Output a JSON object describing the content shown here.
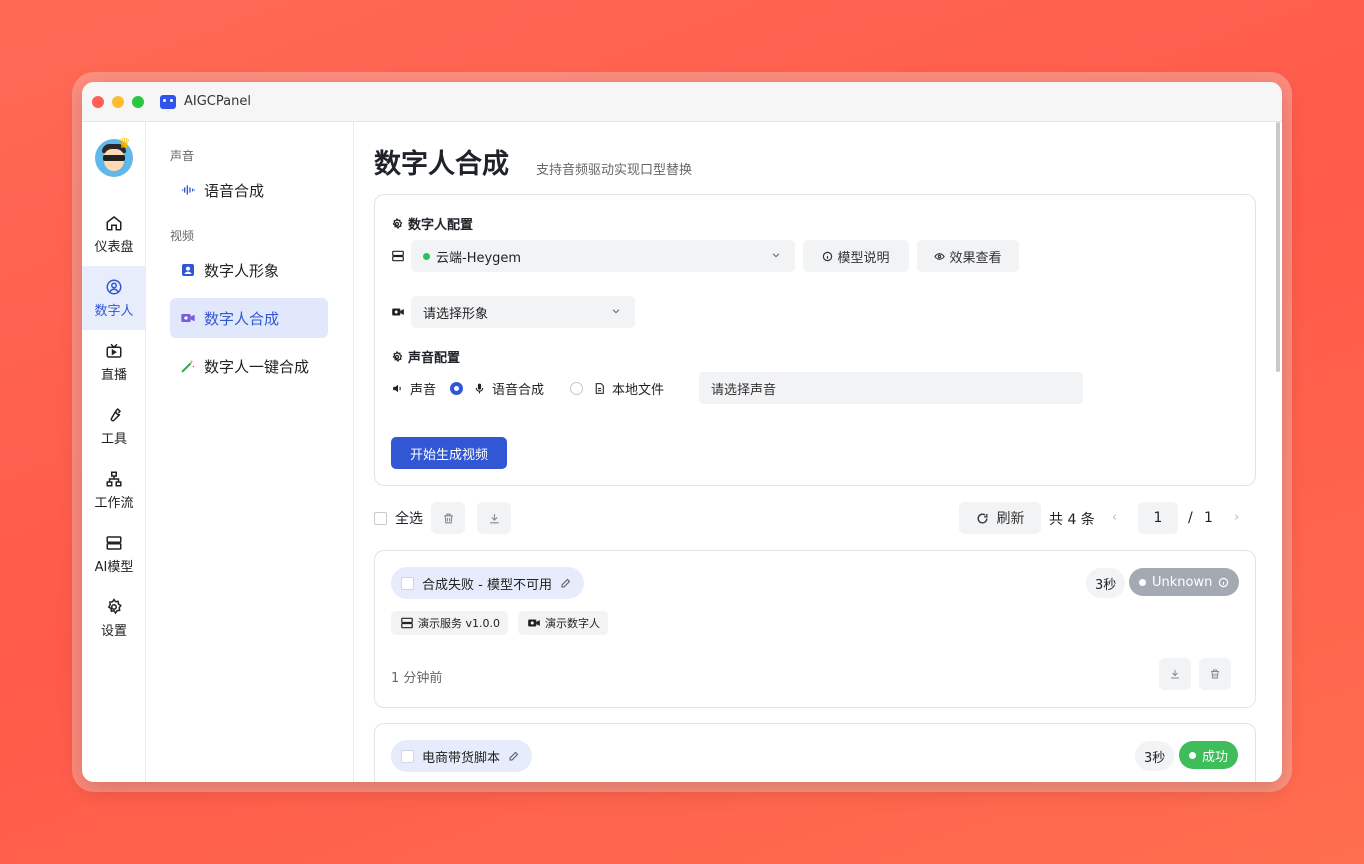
{
  "app": {
    "title": "AIGCPanel"
  },
  "rail": {
    "items": [
      {
        "label": "仪表盘",
        "icon": "home-icon"
      },
      {
        "label": "数字人",
        "icon": "user-circle-icon"
      },
      {
        "label": "直播",
        "icon": "tv-icon"
      },
      {
        "label": "工具",
        "icon": "wrench-icon"
      },
      {
        "label": "工作流",
        "icon": "workflow-icon"
      },
      {
        "label": "AI模型",
        "icon": "server-icon"
      },
      {
        "label": "设置",
        "icon": "gear-icon"
      }
    ],
    "active": "数字人"
  },
  "sidebar": {
    "sections": [
      {
        "title": "声音",
        "items": [
          {
            "label": "语音合成",
            "icon": "waveform-icon"
          }
        ]
      },
      {
        "title": "视频",
        "items": [
          {
            "label": "数字人形象",
            "icon": "portrait-icon"
          },
          {
            "label": "数字人合成",
            "icon": "video-camera-icon"
          },
          {
            "label": "数字人一键合成",
            "icon": "magic-wand-icon"
          }
        ]
      }
    ],
    "active": "数字人合成"
  },
  "page": {
    "title": "数字人合成",
    "subtitle": "支持音频驱动实现口型替换"
  },
  "config": {
    "digital_human_heading": "数字人配置",
    "model_select_value": "云端-Heygem",
    "model_status_color": "#2fbf5b",
    "model_info_button": "模型说明",
    "effect_view_button": "效果查看",
    "avatar_select_placeholder": "请选择形象",
    "voice_heading": "声音配置",
    "voice_label": "声音",
    "voice_options": [
      {
        "label": "语音合成",
        "selected": true
      },
      {
        "label": "本地文件",
        "selected": false
      }
    ],
    "voice_select_placeholder": "请选择声音",
    "generate_button": "开始生成视频"
  },
  "toolbar": {
    "select_all": "全选",
    "refresh": "刷新",
    "total": "共 4 条",
    "page_current": "1",
    "page_separator": "/",
    "page_total": "1"
  },
  "tasks": [
    {
      "title": "合成失败 - 模型不可用",
      "duration": "3秒",
      "status": "Unknown",
      "status_color": "#a5a9b1",
      "tags": [
        "演示服务 v1.0.0",
        "演示数字人"
      ],
      "time_ago": "1 分钟前"
    },
    {
      "title": "电商带货脚本",
      "duration": "3秒",
      "status": "成功",
      "status_color": "#3ebd5a"
    }
  ],
  "colors": {
    "accent": "#3157d5",
    "background": "#ff5a4a"
  }
}
